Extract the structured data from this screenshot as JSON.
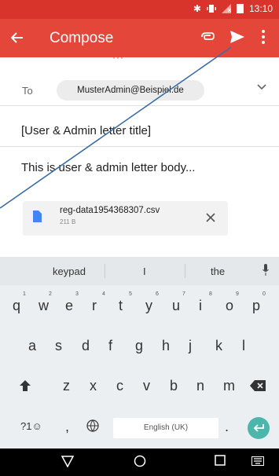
{
  "status": {
    "time": "13:10"
  },
  "appbar": {
    "title": "Compose",
    "back_icon": "arrow-left-icon",
    "attach_icon": "paperclip-icon",
    "send_icon": "send-icon",
    "more_icon": "more-vert-icon"
  },
  "from_strip": {
    "text": "···"
  },
  "to": {
    "label": "To",
    "recipient": "MusterAdmin@Beispiel.de"
  },
  "subject": "[User & Admin letter title]",
  "body": "This is user & admin letter body...",
  "attachment": {
    "name": "reg-data1954368307.csv",
    "size": "211 B"
  },
  "keyboard": {
    "suggestions": [
      "keypad",
      "I",
      "the"
    ],
    "row1": [
      [
        "q",
        "1"
      ],
      [
        "w",
        "2"
      ],
      [
        "e",
        "3"
      ],
      [
        "r",
        "4"
      ],
      [
        "t",
        "5"
      ],
      [
        "y",
        "6"
      ],
      [
        "u",
        "7"
      ],
      [
        "i",
        "8"
      ],
      [
        "o",
        "9"
      ],
      [
        "p",
        "0"
      ]
    ],
    "row2": [
      "a",
      "s",
      "d",
      "f",
      "g",
      "h",
      "j",
      "k",
      "l"
    ],
    "row3": [
      "z",
      "x",
      "c",
      "v",
      "b",
      "n",
      "m"
    ],
    "bottom": {
      "symbols": "?1☺",
      "comma": ",",
      "period": ".",
      "space_label": "English (UK)"
    }
  },
  "colors": {
    "appbar": "#e5463a",
    "statusbar": "#d8342b",
    "enter": "#4db6ac",
    "annotation_line": "#3a6ea5"
  }
}
